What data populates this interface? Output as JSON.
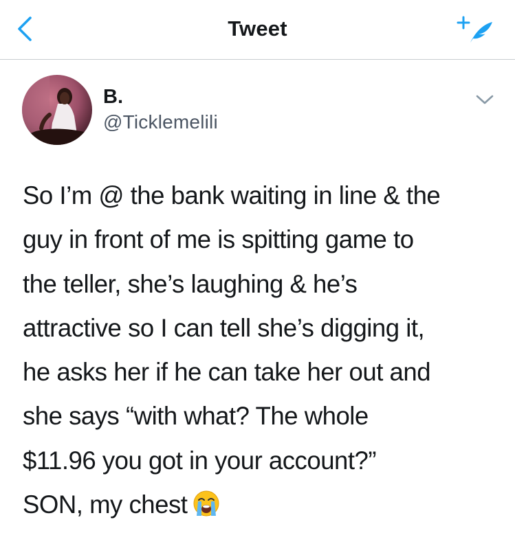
{
  "nav": {
    "title": "Tweet",
    "back_icon": "chevron-left-icon",
    "compose_icon": "compose-quill-icon"
  },
  "author": {
    "display_name": "B.",
    "handle": "@Ticklemelili",
    "menu_icon": "chevron-down-icon"
  },
  "tweet": {
    "text_lines": [
      "So I’m @ the bank waiting in line & the",
      "guy in front of me is spitting game to",
      "the teller, she’s laughing & he’s",
      "attractive so I can tell she’s digging it,",
      "he asks her if he can take her out and",
      "she says “with what? The whole",
      "$11.96 you got in your account?”",
      "SON, my chest"
    ],
    "emoji": "loudly-crying-face-icon"
  },
  "colors": {
    "accent": "#1da1f2",
    "text": "#14171a",
    "secondary_text": "#4b5563",
    "divider": "#c8ccd0"
  }
}
